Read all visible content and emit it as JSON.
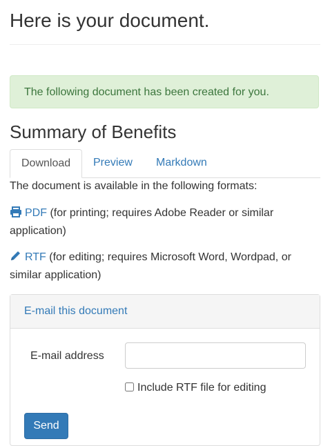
{
  "page": {
    "title": "Here is your document."
  },
  "alert": {
    "message": "The following document has been created for you."
  },
  "section": {
    "title": "Summary of Benefits"
  },
  "tabs": [
    {
      "label": "Download",
      "active": true
    },
    {
      "label": "Preview",
      "active": false
    },
    {
      "label": "Markdown",
      "active": false
    }
  ],
  "download": {
    "intro": "The document is available in the following formats:",
    "formats": [
      {
        "icon": "printer-icon",
        "label": "PDF",
        "description": "(for printing; requires Adobe Reader or similar application)"
      },
      {
        "icon": "pencil-icon",
        "label": "RTF",
        "description": "(for editing; requires Microsoft Word, Wordpad, or similar application)"
      }
    ]
  },
  "email_panel": {
    "heading": "E-mail this document",
    "email_label": "E-mail address",
    "email_value": "",
    "checkbox_label": "Include RTF file for editing",
    "checkbox_checked": false,
    "send_label": "Send"
  },
  "colors": {
    "link": "#337ab7",
    "alert_bg": "#dff0d8",
    "alert_text": "#3c763d",
    "button": "#337ab7"
  }
}
